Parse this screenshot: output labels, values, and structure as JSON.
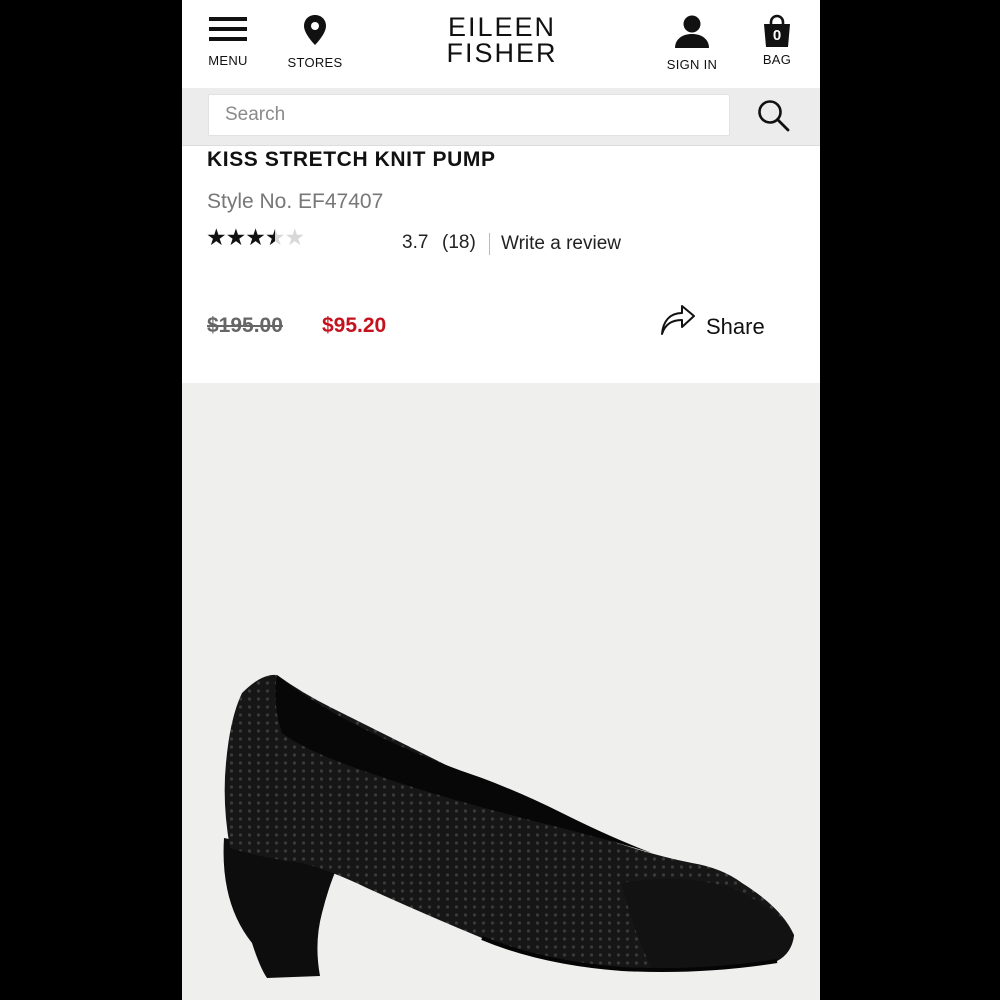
{
  "header": {
    "menu_label": "MENU",
    "stores_label": "STORES",
    "logo_line1": "EILEEN",
    "logo_line2": "FISHER",
    "signin_label": "SIGN IN",
    "bag_label": "BAG",
    "bag_count": "0"
  },
  "search": {
    "placeholder": "Search"
  },
  "product": {
    "title": "KISS STRETCH KNIT PUMP",
    "style_no": "Style No. EF47407",
    "rating": {
      "stars_max": 5,
      "stars_value": 3.7,
      "value_text": "3.7",
      "count_text": "(18)"
    },
    "write_review": "Write a review",
    "original_price": "$195.00",
    "sale_price": "$95.20",
    "share_label": "Share",
    "image": "black-knit-pump-shoe"
  },
  "colors": {
    "sale_red": "#c4121e",
    "image_bg": "#efefee"
  }
}
